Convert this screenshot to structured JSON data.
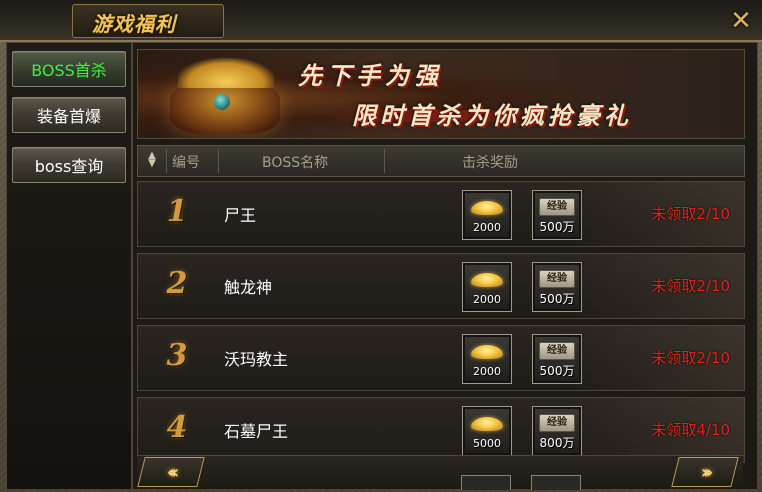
{
  "window": {
    "title": "游戏福利",
    "close_glyph": "✕"
  },
  "sidebar": {
    "items": [
      {
        "label": "BOSS首杀",
        "active": true
      },
      {
        "label": "装备首爆",
        "active": false
      },
      {
        "label": "boss查询",
        "active": false
      }
    ]
  },
  "banner": {
    "line1": "先下手为强",
    "line2": "限时首杀为你疯抢豪礼"
  },
  "table": {
    "headers": {
      "num": "编号",
      "name": "BOSS名称",
      "reward": "击杀奖励"
    },
    "exp_tag": "经验",
    "rows": [
      {
        "num": "1",
        "name": "尸王",
        "gold": "2000",
        "exp": "500万",
        "status": "未领取2/10"
      },
      {
        "num": "2",
        "name": "触龙神",
        "gold": "2000",
        "exp": "500万",
        "status": "未领取2/10"
      },
      {
        "num": "3",
        "name": "沃玛教主",
        "gold": "2000",
        "exp": "500万",
        "status": "未领取2/10"
      },
      {
        "num": "4",
        "name": "石墓尸王",
        "gold": "5000",
        "exp": "800万",
        "status": "未领取4/10"
      }
    ]
  },
  "pager": {
    "prev": "‹‹‹",
    "next": "›››"
  },
  "colors": {
    "accent_gold": "#f0c25a",
    "active_green": "#3cf23c",
    "status_red": "#e32020"
  }
}
